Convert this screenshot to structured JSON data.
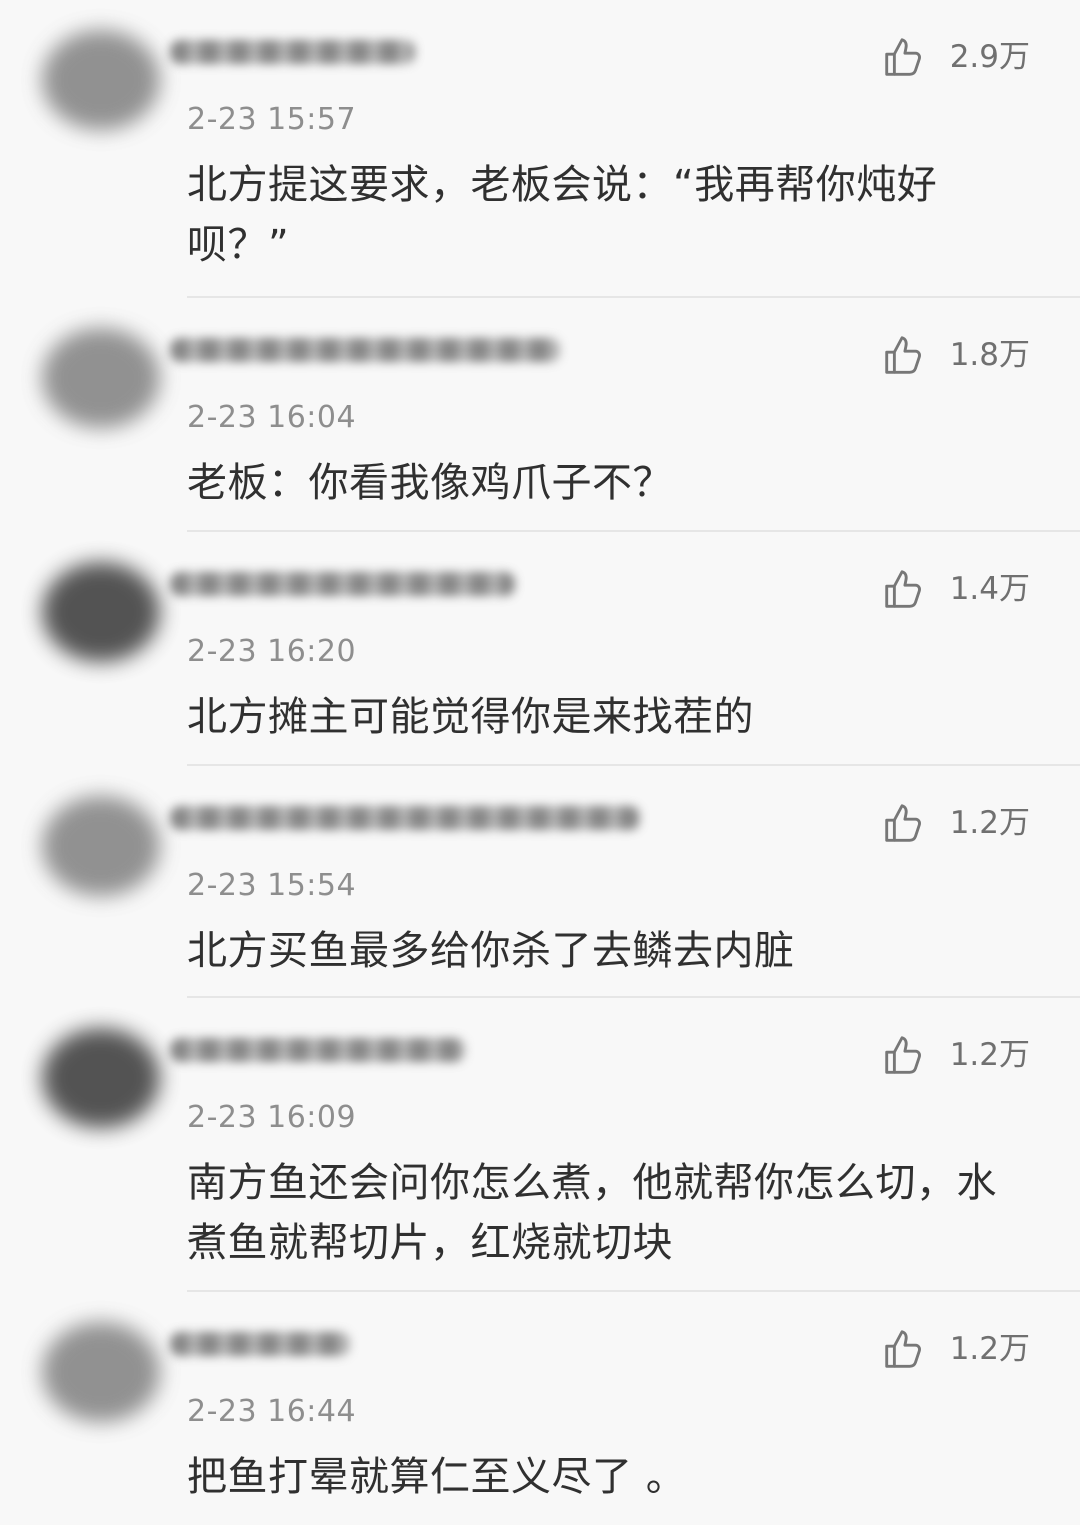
{
  "comments": [
    {
      "time": "2-23 15:57",
      "likes": "2.9万",
      "text": "北方提这要求，老板会说：“我再帮你炖好\n呗？”"
    },
    {
      "time": "2-23 16:04",
      "likes": "1.8万",
      "text": "老板：你看我像鸡爪子不？"
    },
    {
      "time": "2-23 16:20",
      "likes": "1.4万",
      "text": "北方摊主可能觉得你是来找茬的"
    },
    {
      "time": "2-23 15:54",
      "likes": "1.2万",
      "text": "北方买鱼最多给你杀了去鳞去内脏"
    },
    {
      "time": "2-23 16:09",
      "likes": "1.2万",
      "text": "南方鱼还会问你怎么煮，他就帮你怎么切，水\n煮鱼就帮切片，红烧就切块"
    },
    {
      "time": "2-23 16:44",
      "likes": "1.2万",
      "text": "把鱼打晕就算仁至义尽了 。"
    }
  ],
  "icons": {
    "like": "thumbs-up-icon"
  },
  "colors": {
    "background": "#f8f8f8",
    "text": "#303030",
    "meta": "#8e8e8e",
    "divider": "#e6e6e6"
  }
}
